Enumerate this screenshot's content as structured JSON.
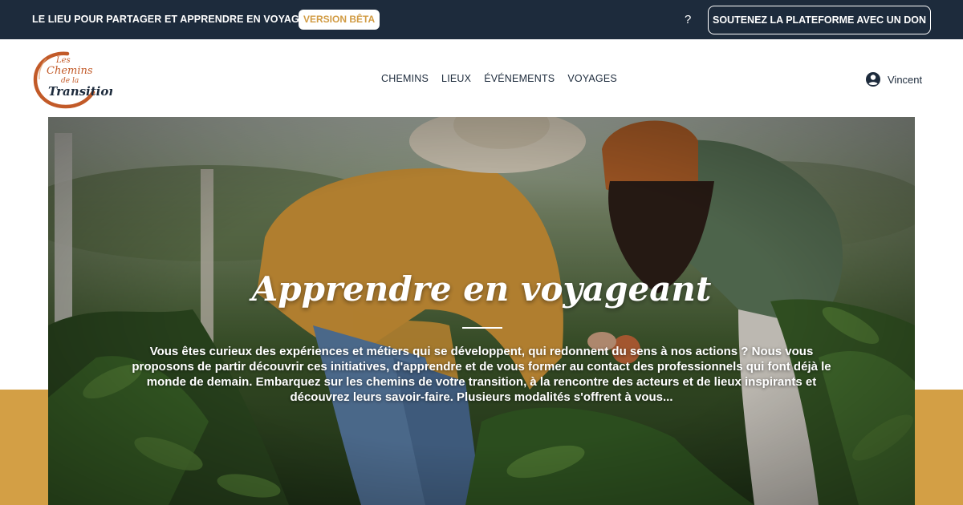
{
  "topbar": {
    "tagline": "LE LIEU POUR PARTAGER ET APPRENDRE EN VOYAGEANT",
    "beta_badge": "VERSION BÊTA",
    "help": "?",
    "donate_label": "SOUTENEZ LA PLATEFORME AVEC UN DON"
  },
  "header": {
    "logo_text": "Les Chemins de la Transition",
    "nav": [
      "CHEMINS",
      "LIEUX",
      "ÉVÉNEMENTS",
      "VOYAGES"
    ],
    "user": {
      "name": "Vincent",
      "icon": "user-circle-icon"
    }
  },
  "hero": {
    "title": "Apprendre en voyageant",
    "text": "Vous êtes curieux des expériences et métiers qui se développent, qui redonnent du sens à nos actions ? Nous vous proposons de partir découvrir ces initiatives, d'apprendre et de vous former au contact des professionnels qui font déjà le monde de demain. Embarquez sur les chemins de votre transition, à la rencontre des acteurs et de lieux inspirants et découvrez leurs savoir-faire. Plusieurs modalités s'offrent à vous..."
  },
  "colors": {
    "navy": "#1d2b3c",
    "gold": "#d39f45",
    "logo_orange": "#c25a28"
  }
}
